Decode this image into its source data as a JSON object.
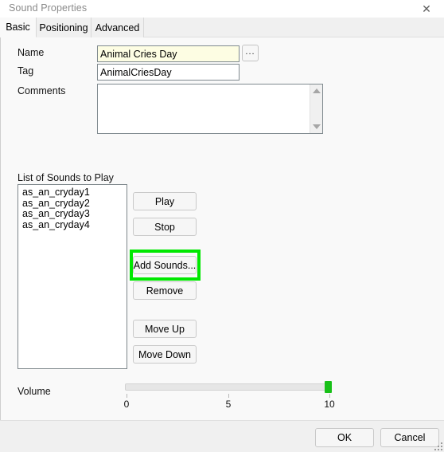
{
  "window": {
    "title": "Sound Properties",
    "close_label": "✕"
  },
  "tabs": [
    {
      "label": "Basic",
      "active": true
    },
    {
      "label": "Positioning",
      "active": false
    },
    {
      "label": "Advanced",
      "active": false
    }
  ],
  "form": {
    "name_label": "Name",
    "name_value": "Animal Cries Day",
    "name_placeholder": "",
    "browse_label": "...",
    "tag_label": "Tag",
    "tag_value": "AnimalCriesDay",
    "tag_placeholder": "",
    "comments_label": "Comments",
    "comments_value": "",
    "comments_placeholder": ""
  },
  "sounds": {
    "caption": "List of Sounds to Play",
    "items": [
      "as_an_cryday1",
      "as_an_cryday2",
      "as_an_cryday3",
      "as_an_cryday4"
    ]
  },
  "actions": {
    "play": "Play",
    "stop": "Stop",
    "add_sounds": "Add Sounds...",
    "remove": "Remove",
    "move_up": "Move Up",
    "move_down": "Move Down"
  },
  "volume": {
    "label": "Volume",
    "value": 10,
    "min": 0,
    "max": 10,
    "ticks": [
      "0",
      "5",
      "10"
    ],
    "thumb_color": "#18c018"
  },
  "highlight": {
    "target": "add_sounds",
    "color": "#00e800"
  },
  "footer": {
    "ok": "OK",
    "cancel": "Cancel"
  }
}
